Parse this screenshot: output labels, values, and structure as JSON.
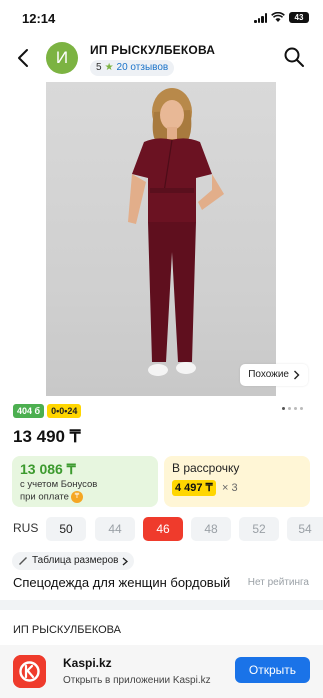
{
  "status_bar": {
    "time": "12:14",
    "battery": "43"
  },
  "header": {
    "avatar_letter": "И",
    "shop_name": "ИП РЫСКУЛБЕКОВА",
    "rating": "5",
    "reviews": "20 отзывов"
  },
  "gallery": {
    "similar_label": "Похожие"
  },
  "badges": {
    "green": "404 б",
    "yellow": "0•0•24"
  },
  "price": "13 490 ₸",
  "bonus": {
    "value": "13 086 ₸",
    "note_line1": "с учетом Бонусов",
    "note_line2": "при оплате",
    "coin": "₸"
  },
  "installment": {
    "title": "В рассрочку",
    "amount": "4 497 ₸",
    "times": "× 3"
  },
  "sizes": {
    "system": "RUS",
    "options": [
      "50",
      "44",
      "46",
      "48",
      "52",
      "54"
    ],
    "selected": "46",
    "available": [
      "50",
      "46"
    ]
  },
  "size_table_label": "Таблица размеров",
  "product_title": "Спецодежда для женщин бордовый",
  "no_rating": "Нет рейтинга",
  "seller_name": "ИП РЫСКУЛБЕКОВА",
  "banner": {
    "title": "Kaspi.kz",
    "subtitle": "Открыть в приложении Kaspi.kz",
    "button": "Открыть"
  },
  "colors": {
    "brand_red": "#ef3b2c",
    "bonus_green": "#3c9a2e",
    "accent_blue": "#1a73e8",
    "garment": "#6b1222"
  }
}
